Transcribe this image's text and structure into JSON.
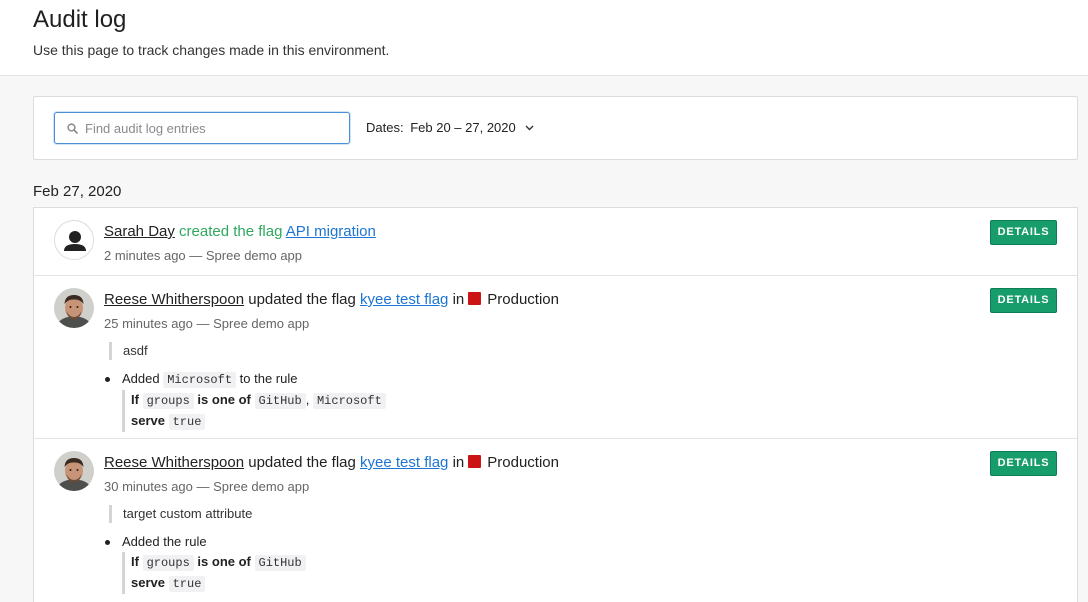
{
  "header": {
    "title": "Audit log",
    "subtitle": "Use this page to track changes made in this environment."
  },
  "filters": {
    "search_placeholder": "Find audit log entries",
    "search_value": "",
    "dates_label": "Dates:",
    "dates_value": "Feb 20 – 27, 2020"
  },
  "groups": [
    {
      "date": "Feb 27, 2020",
      "entries": [
        {
          "user": "Sarah Day",
          "action": "created the flag",
          "flag": "API migration",
          "meta": "2 minutes ago — Spree demo app",
          "details_label": "DETAILS"
        },
        {
          "user": "Reese Whitherspoon",
          "action": "updated the flag",
          "flag": "kyee test flag",
          "in_word": "in",
          "environment": "Production",
          "environment_color": "#cc1414",
          "meta": "25 minutes ago — Spree demo app",
          "details_label": "DETAILS",
          "comment": "asdf",
          "change": {
            "prefix": "Added",
            "value": "Microsoft",
            "suffix": "to the rule",
            "if_kw": "If",
            "attribute": "groups",
            "operator": "is one of",
            "values": [
              "GitHub",
              "Microsoft"
            ],
            "separator": ",",
            "serve_kw": "serve",
            "serve_value": "true"
          }
        },
        {
          "user": "Reese Whitherspoon",
          "action": "updated the flag",
          "flag": "kyee test flag",
          "in_word": "in",
          "environment": "Production",
          "environment_color": "#cc1414",
          "meta": "30 minutes ago — Spree demo app",
          "details_label": "DETAILS",
          "comment": "target custom attribute",
          "change": {
            "text": "Added the rule",
            "if_kw": "If",
            "attribute": "groups",
            "operator": "is one of",
            "values": [
              "GitHub"
            ],
            "serve_kw": "serve",
            "serve_value": "true"
          }
        }
      ]
    }
  ],
  "colors": {
    "accent_green": "#179c6b",
    "created_green": "#2fa85f",
    "link_blue": "#1d75d3",
    "focus_blue": "#4a90d9"
  },
  "icons": {
    "search": "search-icon",
    "dropdown": "chevron-down-icon",
    "default_avatar": "user-silhouette-icon"
  }
}
